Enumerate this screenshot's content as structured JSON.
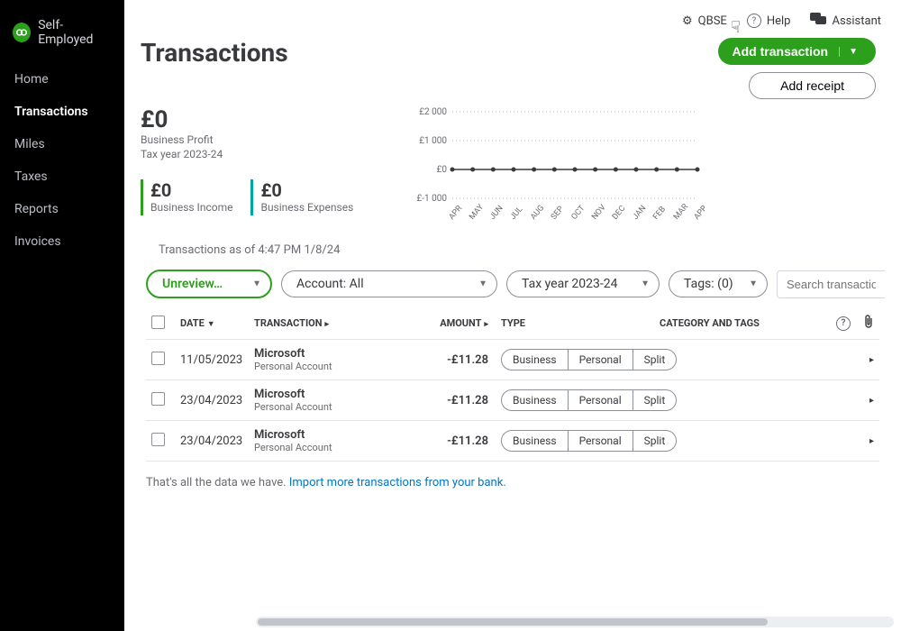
{
  "brand": {
    "name": "Self-Employed"
  },
  "sidebar": {
    "items": [
      {
        "label": "Home"
      },
      {
        "label": "Transactions"
      },
      {
        "label": "Miles"
      },
      {
        "label": "Taxes"
      },
      {
        "label": "Reports"
      },
      {
        "label": "Invoices"
      }
    ],
    "active_index": 1
  },
  "topbar": {
    "settings_label": "QBSE",
    "help_label": "Help",
    "assistant_label": "Assistant"
  },
  "page": {
    "title": "Transactions",
    "add_transaction_label": "Add transaction",
    "add_receipt_label": "Add receipt"
  },
  "summary": {
    "profit_amount": "£0",
    "profit_label": "Business Profit",
    "tax_year_label": "Tax year 2023-24",
    "income_amount": "£0",
    "income_label": "Business Income",
    "expenses_amount": "£0",
    "expenses_label": "Business Expenses"
  },
  "chart_data": {
    "type": "line",
    "categories": [
      "APR",
      "MAY",
      "JUN",
      "JUL",
      "AUG",
      "SEP",
      "OCT",
      "NOV",
      "DEC",
      "JAN",
      "FEB",
      "MAR",
      "APR"
    ],
    "values": [
      0,
      0,
      0,
      0,
      0,
      0,
      0,
      0,
      0,
      0,
      0,
      0,
      0
    ],
    "ylabel": "",
    "ylim": [
      -1000,
      2000
    ],
    "y_ticks": [
      "£2 000",
      "£1 000",
      "£0",
      "£-1 000"
    ]
  },
  "meta": {
    "timestamp_line": "Transactions as of 4:47 PM 1/8/24"
  },
  "filters": {
    "status": "Unreview…",
    "account": "Account: All",
    "tax_year": "Tax year 2023-24",
    "tags": "Tags: (0)",
    "search_placeholder": "Search transactions"
  },
  "table": {
    "headers": {
      "date": "Date",
      "transaction": "Transaction",
      "amount": "Amount",
      "type": "Type",
      "category": "Category and Tags"
    },
    "segment_labels": {
      "business": "Business",
      "personal": "Personal",
      "split": "Split"
    },
    "rows": [
      {
        "date": "11/05/2023",
        "merchant": "Microsoft",
        "account": "Personal Account",
        "amount": "-£11.28"
      },
      {
        "date": "23/04/2023",
        "merchant": "Microsoft",
        "account": "Personal Account",
        "amount": "-£11.28"
      },
      {
        "date": "23/04/2023",
        "merchant": "Microsoft",
        "account": "Personal Account",
        "amount": "-£11.28"
      }
    ]
  },
  "footer": {
    "prefix": "That's all the data we have. ",
    "link": "Import more transactions from your bank."
  }
}
